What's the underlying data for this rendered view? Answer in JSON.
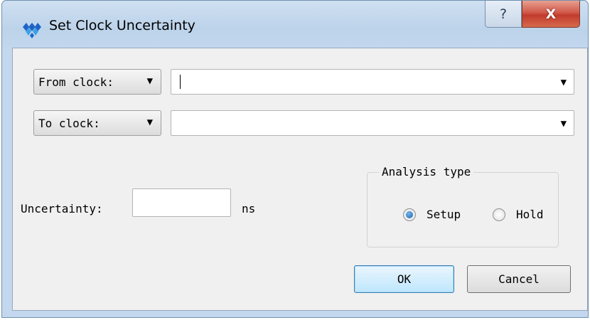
{
  "window": {
    "title": "Set Clock Uncertainty",
    "help_label": "?",
    "close_label": "X"
  },
  "from_clock": {
    "selector_label": "From clock:",
    "value": ""
  },
  "to_clock": {
    "selector_label": "To clock:",
    "value": ""
  },
  "uncertainty": {
    "label": "Uncertainty:",
    "value": "",
    "unit": "ns"
  },
  "analysis_type": {
    "title": "Analysis type",
    "options": [
      {
        "label": "Setup",
        "selected": true
      },
      {
        "label": "Hold",
        "selected": false
      }
    ]
  },
  "buttons": {
    "ok": "OK",
    "cancel": "Cancel"
  },
  "icons": {
    "dropdown": "▼"
  }
}
